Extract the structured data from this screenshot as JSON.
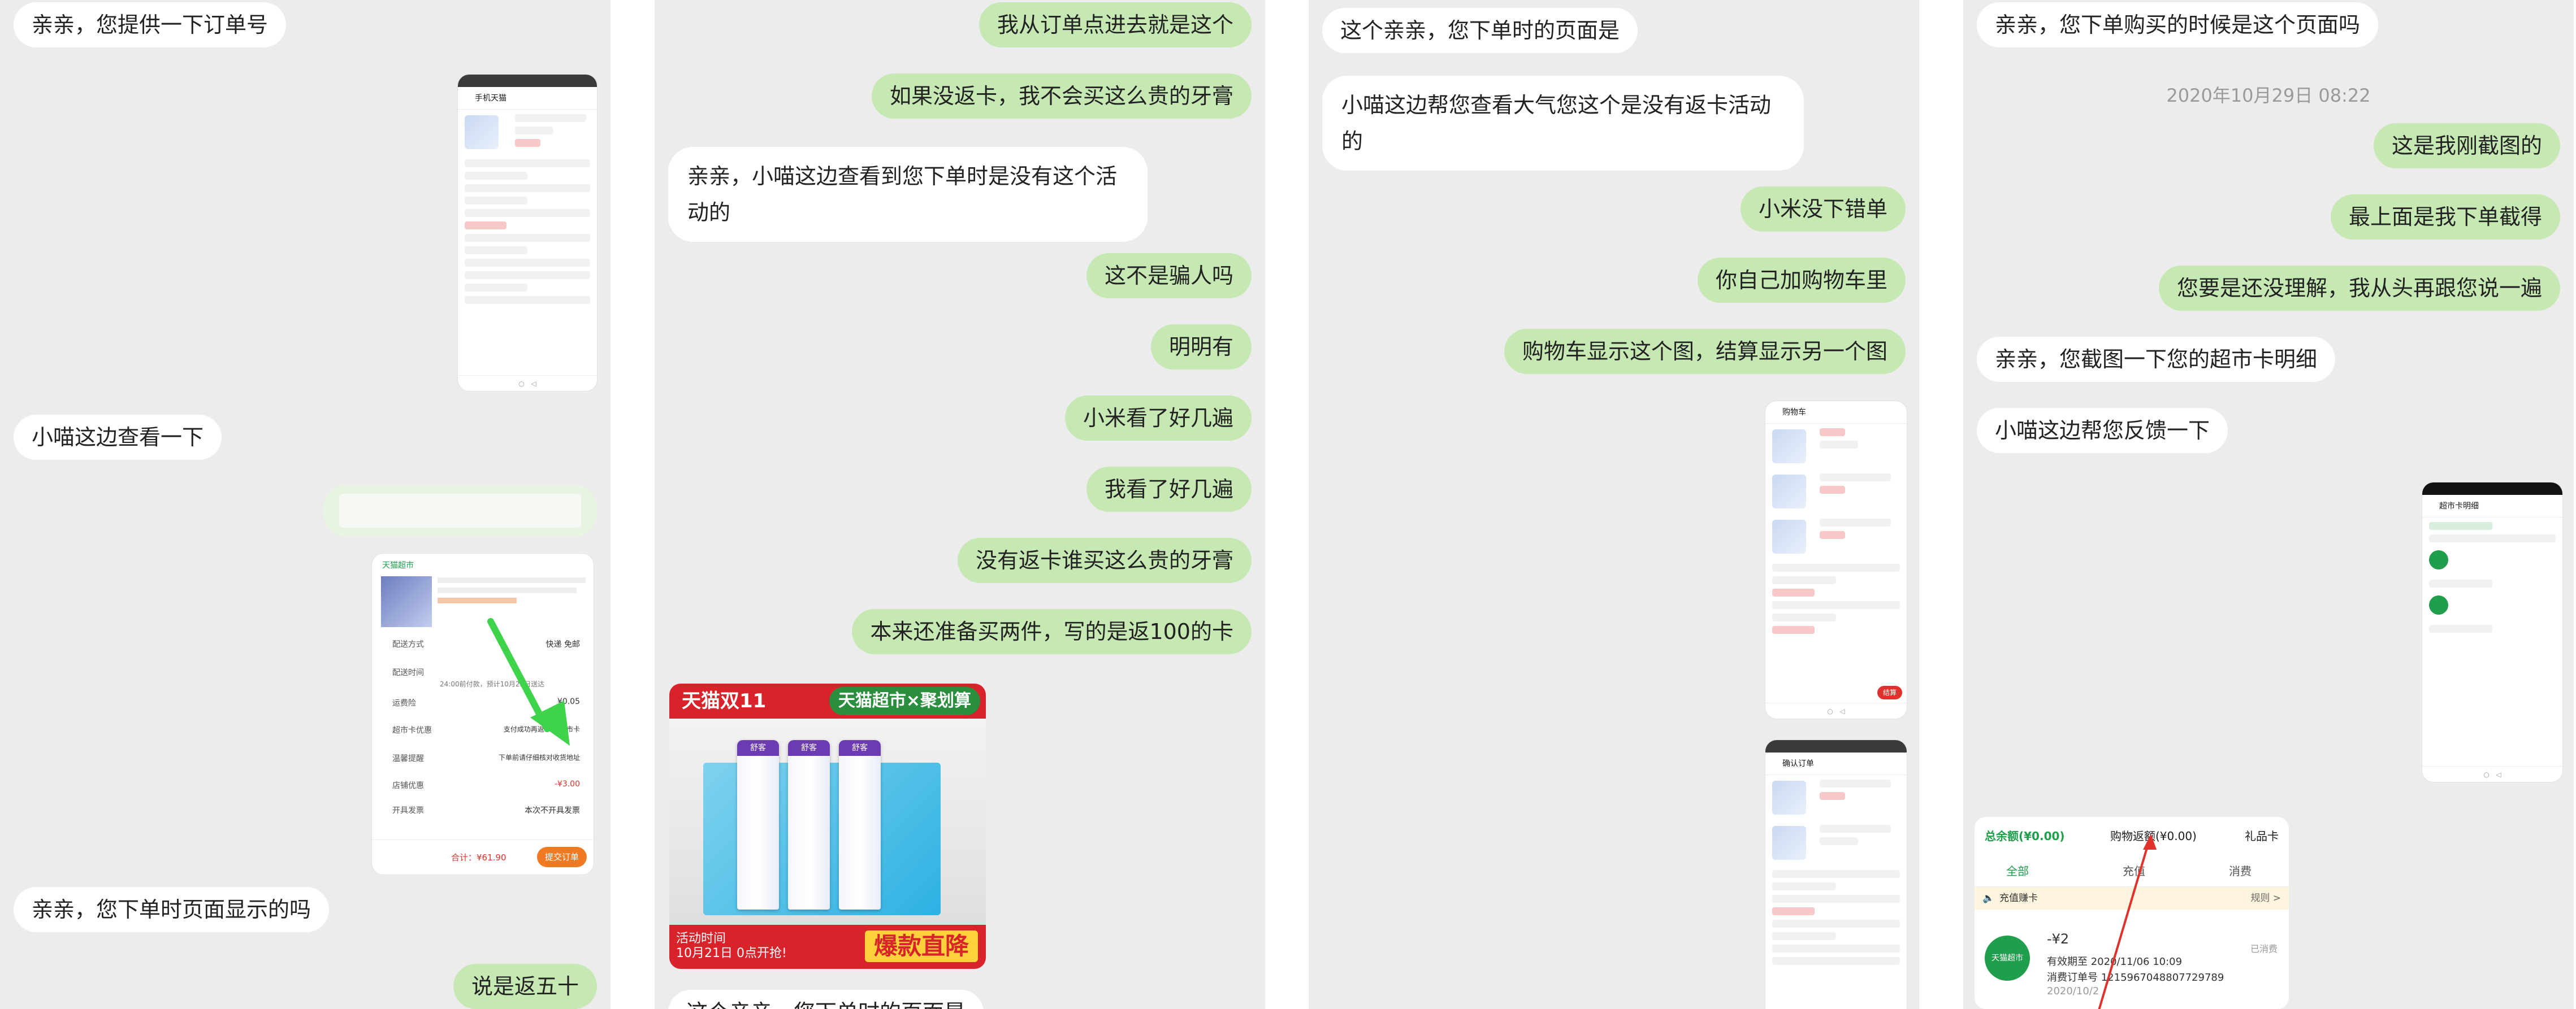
{
  "panel1": {
    "messages": [
      {
        "text": "亲亲，您提供一下订单号"
      },
      {
        "text": "小喵这边查看一下"
      },
      {
        "text": "亲亲，您下单时页面显示的吗"
      },
      {
        "text": "说是返五十"
      }
    ],
    "shot_a": {
      "title": "手机天猫"
    },
    "shot_b": {
      "store": "天猫超市",
      "rows": [
        {
          "label": "配送方式",
          "value": "快递 免邮"
        },
        {
          "label": "配送时间",
          "value": "24:00前付款，预计10月25日送达"
        },
        {
          "label": "运费险",
          "value": "¥0.05"
        },
        {
          "label": "超市卡优惠",
          "value": "支付成功再返50元超市卡"
        },
        {
          "label": "温馨提醒",
          "value": "下单前请仔细核对收货地址"
        },
        {
          "label": "店铺优惠",
          "value": "-¥3.00"
        },
        {
          "label": "开具发票",
          "value": "本次不开具发票"
        }
      ],
      "total": "合计：¥61.90",
      "submit": "提交订单"
    }
  },
  "panel2": {
    "messages": [
      {
        "text": "我从订单点进去就是这个"
      },
      {
        "text": "如果没返卡，我不会买这么贵的牙膏"
      },
      {
        "text": "亲亲，小喵这边查看到您下单时是没有这个活动的"
      },
      {
        "text": "这不是骗人吗"
      },
      {
        "text": "明明有"
      },
      {
        "text": "小米看了好几遍"
      },
      {
        "text": "我看了好几遍"
      },
      {
        "text": "没有返卡谁买这么贵的牙膏"
      },
      {
        "text": "本来还准备买两件，写的是返100的卡"
      },
      {
        "text": "这个亲亲，您下单时的页面是"
      }
    ],
    "promo": {
      "header": "天猫双11",
      "badge": "天猫超市×聚划算",
      "brand": "舒客",
      "time_label": "活动时间",
      "time": "10月21日 0点开抢!",
      "sale": "爆款直降"
    }
  },
  "panel3": {
    "messages": [
      {
        "text": "这个亲亲，您下单时的页面是"
      },
      {
        "text": "小喵这边帮您查看大气您这个是没有返卡活动的"
      },
      {
        "text": "小米没下错单"
      },
      {
        "text": "你自己加购物车里"
      },
      {
        "text": "购物车显示这个图，结算显示另一个图"
      }
    ],
    "shot_cart": {
      "title": "购物车",
      "checkout": "结算"
    },
    "shot_confirm": {
      "title": "确认订单"
    }
  },
  "panel4": {
    "messages": [
      {
        "text": "亲亲，您下单购买的时候是这个页面吗"
      },
      {
        "text": "这是我刚截图的"
      },
      {
        "text": "最上面是我下单截得"
      },
      {
        "text": "您要是还没理解，我从头再跟您说一遍"
      },
      {
        "text": "亲亲，您截图一下您的超市卡明细"
      },
      {
        "text": "小喵这边帮您反馈一下"
      }
    ],
    "timestamp": "2020年10月29日 08:22",
    "shot_card": {
      "title": "超市卡明细"
    },
    "balance": {
      "tabs": [
        "总余额(¥0.00)",
        "购物返额(¥0.00)",
        "礼品卡"
      ],
      "subtabs": [
        "全部",
        "充值",
        "消费"
      ],
      "card_label": "充值赚卡",
      "rules": "规则 >",
      "logo": "天猫超市",
      "amount": "-¥2",
      "valid": "有效期至 2020/11/06 10:09",
      "order": "消费订单号 12159670488077297​89",
      "date": "2020/10/2",
      "status": "已消费"
    }
  },
  "colors": {
    "outgoing_bubble": "#c6e9b4",
    "incoming_bubble": "#ffffff",
    "panel_bg": "#ececec",
    "accent_red": "#d8232a",
    "accent_green": "#1f9e4b"
  }
}
